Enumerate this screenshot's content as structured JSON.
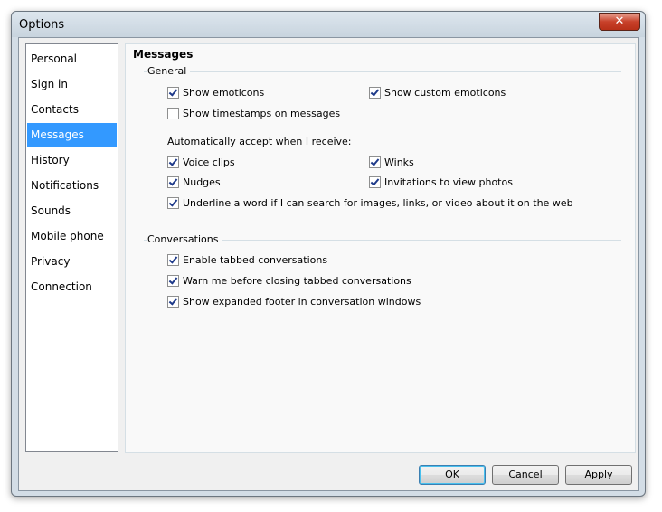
{
  "window": {
    "title": "Options",
    "close": "✕"
  },
  "sidebar": {
    "items": [
      {
        "label": "Personal"
      },
      {
        "label": "Sign in"
      },
      {
        "label": "Contacts"
      },
      {
        "label": "Messages",
        "selected": true
      },
      {
        "label": "History"
      },
      {
        "label": "Notifications"
      },
      {
        "label": "Sounds"
      },
      {
        "label": "Mobile phone"
      },
      {
        "label": "Privacy"
      },
      {
        "label": "Connection"
      }
    ]
  },
  "panel": {
    "title": "Messages",
    "general": {
      "label": "General",
      "show_emoticons": {
        "label": "Show emoticons",
        "checked": true
      },
      "show_custom_emoticons": {
        "label": "Show custom emoticons",
        "checked": true
      },
      "show_timestamps": {
        "label": "Show timestamps on messages",
        "checked": false
      },
      "auto_accept_label": "Automatically accept when I receive:",
      "voice_clips": {
        "label": "Voice clips",
        "checked": true
      },
      "winks": {
        "label": "Winks",
        "checked": true
      },
      "nudges": {
        "label": "Nudges",
        "checked": true
      },
      "invitations": {
        "label": "Invitations to view photos",
        "checked": true
      },
      "underline": {
        "label": "Underline a word if I can search for images, links, or video about it on the web",
        "checked": true
      }
    },
    "conversations": {
      "label": "Conversations",
      "enable_tabbed": {
        "label": "Enable tabbed conversations",
        "checked": true
      },
      "warn_closing": {
        "label": "Warn me before closing tabbed conversations",
        "checked": true
      },
      "expanded_footer": {
        "label": "Show expanded footer in conversation windows",
        "checked": true
      }
    }
  },
  "buttons": {
    "ok": "OK",
    "cancel": "Cancel",
    "apply": "Apply"
  }
}
